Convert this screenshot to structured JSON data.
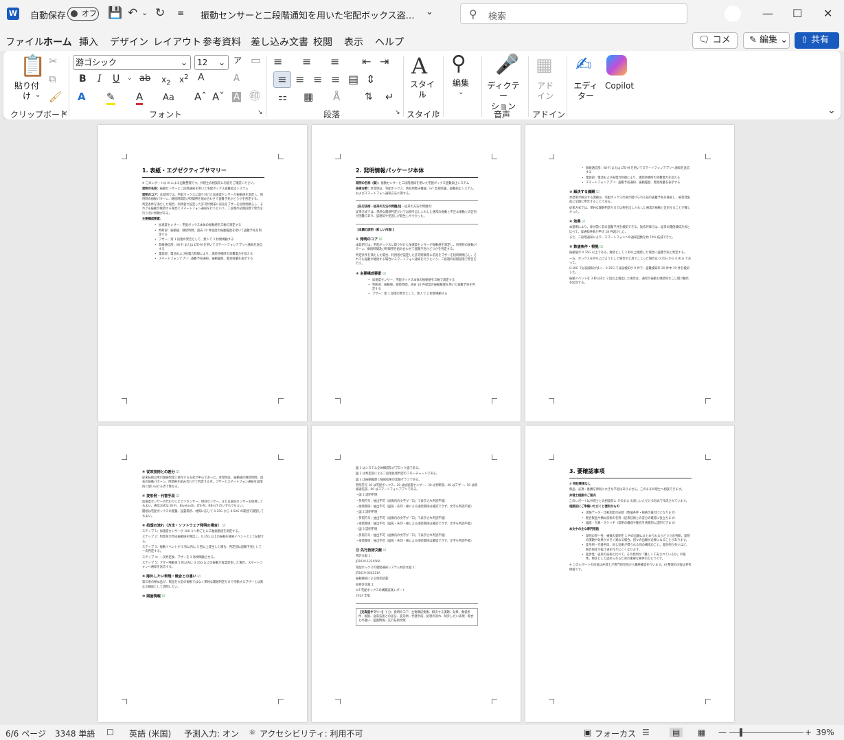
{
  "titlebar": {
    "autosave_label": "自動保存",
    "autosave_state": "オフ",
    "document_title": "振動センサーと二段階通知を用いた宅配ボックス盗難抑止システ…",
    "search_placeholder": "検索"
  },
  "menu": {
    "tabs": [
      "ファイル",
      "ホーム",
      "挿入",
      "デザイン",
      "レイアウト",
      "参考資料",
      "差し込み文書",
      "校閲",
      "表示",
      "ヘルプ"
    ],
    "active": "ホーム",
    "comment": "コメント",
    "edit": "編集",
    "share": "共有"
  },
  "ribbon": {
    "paste": "貼り付け",
    "font_name": "游ゴシック",
    "font_size": "12",
    "style": "スタイル",
    "editing": "編集",
    "dictate": "ディクテー\nション",
    "addins": "アド\nイン",
    "editor": "エディ\nター",
    "copilot": "Copilot",
    "groups": {
      "clipboard": "クリップボード",
      "font": "フォント",
      "paragraph": "段落",
      "styles": "スタイル",
      "voice": "音声",
      "addins": "アドイン"
    }
  },
  "pages": [
    {
      "blocks": [
        {
          "t": "h1",
          "text": "1. 表紙・エグゼクティブサマリー"
        },
        {
          "t": "p",
          "text": "※ このレポートは AI による自動整理です。弁理士の相談前に内容をご確認ください。"
        },
        {
          "t": "p",
          "bold": "発明の名称：",
          "text": "振動センサーと二段階通知を用いた宅配ボックス盗難抑止システム"
        },
        {
          "t": "p",
          "bold": "発明のコア：",
          "text": "本発明では、宅配ボックスに取り付けた加速度センサーが振動値を測定し、利用時の振動パターン、継続時間及び時間帯を組み合わせて盗難予兆かどうかを判定する。"
        },
        {
          "t": "p",
          "text": "判定条件を満たした場合、利用者が設定した許可時間帯に前兆をブザーを短時間鳴らし、それでも振動が継続する場合にスマートフォン通知を行うという、二段階の初期段階で警告を行う点に特徴がある。"
        },
        {
          "t": "p",
          "bold": "主要構成要素："
        },
        {
          "t": "ul",
          "items": [
            "加速度センサー：宅配ボックス本体の振動値を三軸で測定する",
            "判断部：振動値、継続時間、過去 10 件程度の振動履歴を用いて盗難予兆を判定する",
            "ブザー：第 1 段階の警告として、無人で 2 秒間鳴動する",
            "無線通信部：Wi-Fi または LTE-M を用いてスマートフォンアプリへ通知を送信する",
            "電源部：電池および省電力制御により、連続待機時の消費電力を抑える",
            "スマートフォンアプリ：盗難予兆通知、振動履歴、電池残量を表示する"
          ]
        }
      ]
    },
    {
      "blocks": [
        {
          "t": "h1",
          "text": "2. 発明情報パッケージ本体"
        },
        {
          "t": "p",
          "bold": "発明の名称（案）：",
          "text": "振動センサーと二段階通知を用いた宅配ボックス盗難抑止システム"
        },
        {
          "t": "p",
          "bold": "技術分野：",
          "text": "本発明は、宅配ボックス、防犯用電子機器、IoT 監視装置、盗難抑止システム、およびスマートフォン通知方法に関する。"
        },
        {
          "t": "hr"
        },
        {
          "t": "p",
          "bold": "【先行技術・従来の方法の問題点】",
          "text": "・従来の方法の問題点："
        },
        {
          "t": "p",
          "text": "従来方式では、単純な閾値判定だけでは物を出し入れした通常の振動と不正な振動との区別が困難であり、誤通知や見逃しが発生しやすかった。"
        },
        {
          "t": "hr"
        },
        {
          "t": "p",
          "bold": "【本願の説明（新しい内容）】"
        },
        {
          "t": "h2",
          "text": "① 発明のコア"
        },
        {
          "t": "p",
          "text": "本発明では、宅配ボックスに取り付けた加速度センサーが振動値を測定し、利用時の振動パターン、継続時間及び時間帯を組み合わせて盗難予兆かどうかを判定する。"
        },
        {
          "t": "p",
          "text": "判定条件を満たした場合、利用者が設定した許可時間帯に前兆をブザーを短時間鳴らし、それでも振動が継続する場合にスマートフォン通知を行うという、二段階の初期段階で警告を行う。"
        },
        {
          "t": "h2",
          "text": "② 主要構成要素"
        },
        {
          "t": "ul",
          "items": [
            "加速度センサー：宅配ボックス本体の振動値を三軸で測定する",
            "判断部：振動値、継続時間、過去 10 件程度の振動履歴を用いて盗難予兆を判定する",
            "ブザー：第 1 段階の警告として、無人で 2 秒間鳴動する"
          ]
        }
      ]
    },
    {
      "blocks": [
        {
          "t": "ul",
          "items": [
            "無線通信部：Wi-Fi または LTE-M を用いてスマートフォンアプリへ通知を送信する",
            "電源部：電池および省電力制御により、連続待機時の消費電力を抑える",
            "スマートフォンアプリ：盗難予兆通知、振動履歴、電池残量を表示する"
          ]
        },
        {
          "t": "h2",
          "text": "③ 解決する課題"
        },
        {
          "t": "p",
          "text": "本発明が解決する課題は、宅配ボックスの扉が開けられる前の盗難予兆を検知し、被害発生前に早期に警告することである。"
        },
        {
          "t": "p",
          "text": "従来方式では、単純な閾値判定だけでは物を出し入れした通常の振動と区別することが難しかった。"
        },
        {
          "t": "h2",
          "text": "④ 効果"
        },
        {
          "t": "p",
          "text": "本発明により、扉が開く前の盗難予兆を検知できる。試作評価では、従来の閾値検知方式と比べて、誤通知件数が平均 18 件減少した。"
        },
        {
          "t": "p",
          "text": "また、二段階通知により、スマートフォンへの通知回数を約 70% 低減できた。"
        },
        {
          "t": "h2",
          "text": "⑤ 数値条件・根拠"
        },
        {
          "t": "p",
          "text": "振動値が 0.35G 以上である。継続として 2 秒以上継続した場合に盗難予兆と判定する。"
        },
        {
          "t": "p",
          "text": "一方、ボックスを持ち上げようとした場合や工具でこじった場合は 0.35G から 0.91G であった。"
        },
        {
          "t": "p",
          "text": "0.30G では誤検知が多く、0.35G では誤検知が 9 件で、盗難検知率 20 件中 19 件を検知した。"
        },
        {
          "t": "p",
          "text": "振動イベントを 3 秒以内に 3 回以上検出した場合は、通常の振動と継続的なこじ開け動作を区別する。"
        }
      ]
    },
    {
      "blocks": [
        {
          "t": "h2",
          "text": "⑥ 従来技術との差分"
        },
        {
          "t": "p",
          "text": "従来技術は単の閾値判定に依存する方式が中心であった。本発明は、振動値の継続時間、過去の振動パターン、時間帯を組み合わせて判定する点、ブザーとスマートフォン通知を段階的に使い分ける点で異なる。"
        },
        {
          "t": "h2",
          "text": "⑦ 変形例・代替手段"
        },
        {
          "t": "p",
          "text": "加速度センサーの代わりにピエゾセンサー、傾斜センサー、または磁気センサーを使用してもよい。通信方式は Wi-Fi、Bluetooth、LTE-M、NB-IoT のいずれでもよい。"
        },
        {
          "t": "p",
          "text": "閾値は宅配ボックスの重量、設置場所、材質に応じて 0.25G から 0.50G の範囲で調整してもよい。"
        },
        {
          "t": "h2",
          "text": "⑧ 処理の流れ（方法・ソフトウェア発明の場合）"
        },
        {
          "t": "p",
          "text": "ステップ 1：加速度センサーが 100 ミリ秒ごとに三軸振動値を測定する。"
        },
        {
          "t": "p",
          "text": "ステップ 2：判定部が合成振動値を算出し、0.35G 以上の振動を検知イベントとして記録する。"
        },
        {
          "t": "p",
          "text": "ステップ 3：振動イベントが 3 秒以内に 3 回以上発生した場合、判定部は盗難予兆として一次判定する。"
        },
        {
          "t": "p",
          "text": "ステップ 4：一次判定後、ブザーを 2 秒間鳴動させる。"
        },
        {
          "t": "p",
          "text": "ステップ 5：ブザー鳴動後 5 秒以内に 0.35G 以上の振動が再度発生した場合、スマートフォンへ通知を送信する。"
        },
        {
          "t": "h2",
          "text": "⑨ 除外したい表現・競合との違い"
        },
        {
          "t": "p",
          "text": "第三者の類似品が、製品を大型の振動ではなく単純な閾値判定だけで作動するブザーとは異なる構成として説明したい。"
        },
        {
          "t": "h2",
          "text": "⑩ 図面情報"
        }
      ]
    },
    {
      "blocks": [
        {
          "t": "p",
          "text": "図 1 はシステム全体構成及びブロック図である。"
        },
        {
          "t": "p",
          "text": "図 2 は判定部による二段階処理判定のフローチャートである。"
        },
        {
          "t": "p",
          "text": "図 3 は振動履歴と検知結果の実験グラフである。"
        },
        {
          "t": "p",
          "text": "参照符号 10 は宅配ボックス、20 は加速度センサー、30 は判断部、40 はブザー、50 は無線通信部、60 はスマートフォンアプリである。"
        },
        {
          "t": "p",
          "text": "・図 1 説明不明"
        },
        {
          "t": "p",
          "text": "・参照符号：抽出不可（画像内の文字が「口」で表示され判読不能）"
        },
        {
          "t": "p",
          "text": "・接続関係：抽出不可（図形・矢印・線による接続関係は確認できず、文字も判読不能）"
        },
        {
          "t": "p",
          "text": "・図 2 説明不明"
        },
        {
          "t": "p",
          "text": "・参照符号：抽出不可（画像内の文字が「口」で表示され判読不能）"
        },
        {
          "t": "p",
          "text": "・接続関係：抽出不可（図形・矢印・線による接続関係は確認できず、文字も判読不能）"
        },
        {
          "t": "p",
          "text": "・図 3 説明不明"
        },
        {
          "t": "p",
          "text": "・参照符号：抽出不可（画像内の文字が「口」で表示され判読不能）"
        },
        {
          "t": "p",
          "text": "・接続関係：抽出不可（図形・矢印・線による接続関係は確認できず、文字も判読不能）"
        },
        {
          "t": "h2",
          "text": "⑪ 先行技術文献"
        },
        {
          "t": "p",
          "text": "特許文献 1："
        },
        {
          "t": "p",
          "text": "JP2020-123456A"
        },
        {
          "t": "p",
          "text": "宅配ボックスの開閉通知システム特許文献 2："
        },
        {
          "t": "p",
          "text": "JP2019-054321A"
        },
        {
          "t": "p",
          "text": "振動検知による防犯装置："
        },
        {
          "t": "p",
          "text": "非特許文献 1："
        },
        {
          "t": "p",
          "text": "IoT 宅配ボックスの構築実践レポート"
        },
        {
          "t": "p",
          "text": "2024 年版"
        },
        {
          "t": "hr"
        },
        {
          "t": "box",
          "bold": "【充実度サマリー】",
          "text": "十分：発明のコア、主要構成要素、解決する課題、効果、数値条件・根拠、従来技術との差分、変形例・代替手段、処理の流れ、除外したい表現・競合との違い、図面情報、先行技術文献"
        }
      ]
    },
    {
      "blocks": [
        {
          "t": "h1",
          "text": "3. 要確認事項"
        },
        {
          "t": "p",
          "bold": "① 特記事項なし"
        },
        {
          "t": "p",
          "text": "無品、必須・推薦を原則に大きな不足はありません。このまま弁理士へ相談できます。"
        },
        {
          "t": "p",
          "bold": "弁理士相談のご案内"
        },
        {
          "t": "p",
          "text": "このレポートは弁理士との相談前に そのまま お渡しいただける形式で作成されています。"
        },
        {
          "t": "p",
          "bold": "相談前にご準備いただくと便利なもの"
        },
        {
          "t": "ul",
          "items": [
            "実験データ・比較測定の記録（数値条件・根拠の裏付けになります）",
            "競合製品や類似技術の名称（従来技術との差分の確認に役立ちます）",
            "図面・写真・スケッチ（発明の構成や動作を視覚的に説明できます）"
          ]
        },
        {
          "t": "p",
          "bold": "本文中の主な専門用語"
        },
        {
          "t": "ul",
          "items": [
            "発明の単一性：複数の発明を 1 件の出願にまとめられるかどうかの判断。発明の課題や効果が大きく異なる場合、別々の出願が必要になることがあります。",
            "変形例・代替手段：同じ効果が得られる別の構成のこと。変形例が多いほど、競合他社が抜け道を作りにくくなります。",
            "進歩性：従来の技術と比べて、その発明が「難しく工夫されているか」の基準。特許として認められるための重要な要件のひとつです。"
          ]
        },
        {
          "t": "p",
          "text": "※ このレポートの内容は弁理士が専門的見地から最終確認を行います。AI 整理の内容は参考情報です。"
        }
      ]
    }
  ],
  "status": {
    "page": "6/6 ページ",
    "words": "3348 単語",
    "lang": "英語 (米国)",
    "predict": "予測入力: オン",
    "access": "アクセシビリティ: 利用不可",
    "focus": "フォーカス",
    "zoom": "39%"
  }
}
